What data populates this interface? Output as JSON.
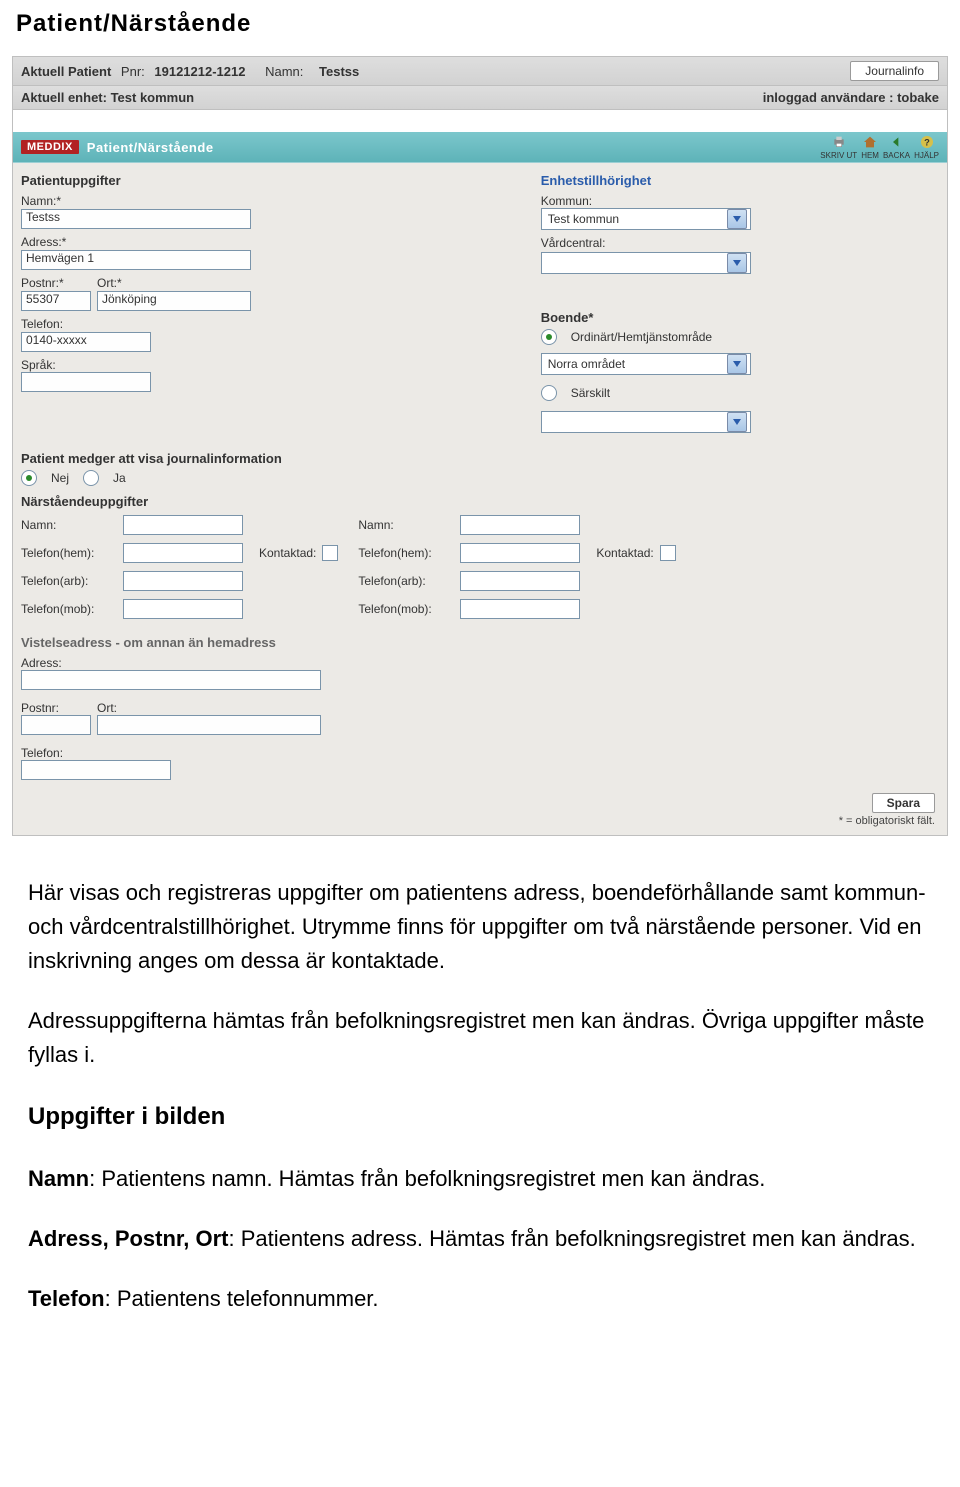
{
  "doc": {
    "title": "Patient/Närstående",
    "para1": "Här visas och registreras uppgifter om patientens adress, boendeförhållande samt kommun- och vårdcentralstillhörighet. Utrymme finns för uppgifter om två närstående personer. Vid en inskrivning anges om dessa är kontaktade.",
    "para2": "Adressuppgifterna hämtas från befolkningsregistret men kan ändras. Övriga uppgifter måste fyllas i.",
    "h2": "Uppgifter i bilden",
    "namn_label": "Namn",
    "namn_text": ": Patientens namn. Hämtas från befolkningsregistret men kan ändras.",
    "adr_label": "Adress, Postnr, Ort",
    "adr_text": ": Patientens adress. Hämtas från befolkningsregistret men kan ändras.",
    "tel_label": "Telefon",
    "tel_text": ": Patientens telefonnummer."
  },
  "header": {
    "aktuell_patient_label": "Aktuell Patient",
    "pnr_label": "Pnr:",
    "pnr_value": "19121212-1212",
    "namn_label": "Namn:",
    "namn_value": "Testss",
    "journalinfo_btn": "Journalinfo",
    "aktuell_enhet_label": "Aktuell enhet: Test kommun",
    "inloggad_label": "inloggad användare : tobake"
  },
  "brand": {
    "logo": "MEDDIX",
    "title": "Patient/Närstående",
    "icons": {
      "print": "SKRIV UT",
      "home": "HEM",
      "back": "BACKA",
      "help": "HJÄLP"
    }
  },
  "form": {
    "patientuppgifter": "Patientuppgifter",
    "namn_lbl": "Namn:*",
    "namn_val": "Testss",
    "adress_lbl": "Adress:*",
    "adress_val": "Hemvägen 1",
    "postnr_lbl": "Postnr:*",
    "ort_lbl": "Ort:*",
    "postnr_val": "55307",
    "ort_val": "Jönköping",
    "telefon_lbl": "Telefon:",
    "telefon_val": "0140-xxxxx",
    "sprak_lbl": "Språk:",
    "sprak_val": "",
    "enhet_title": "Enhetstillhörighet",
    "kommun_lbl": "Kommun:",
    "kommun_val": "Test kommun",
    "vard_lbl": "Vårdcentral:",
    "vard_val": "",
    "boende_title": "Boende*",
    "boende_opt1": "Ordinärt/Hemtjänstområde",
    "boende_sel1": "Norra området",
    "boende_opt2": "Särskilt",
    "boende_sel2": "",
    "medger_title": "Patient medger att visa journalinformation",
    "nej": "Nej",
    "ja": "Ja",
    "narstaende_title": "Närståendeuppgifter",
    "n_namn": "Namn:",
    "n_tel_hem": "Telefon(hem):",
    "n_tel_arb": "Telefon(arb):",
    "n_tel_mob": "Telefon(mob):",
    "kontaktad": "Kontaktad:",
    "vist_title": "Vistelseadress - om annan än hemadress",
    "vist_adr": "Adress:",
    "vist_postnr": "Postnr:",
    "vist_ort": "Ort:",
    "vist_tel": "Telefon:"
  },
  "footer": {
    "spara": "Spara",
    "note": "* = obligatoriskt fält."
  }
}
